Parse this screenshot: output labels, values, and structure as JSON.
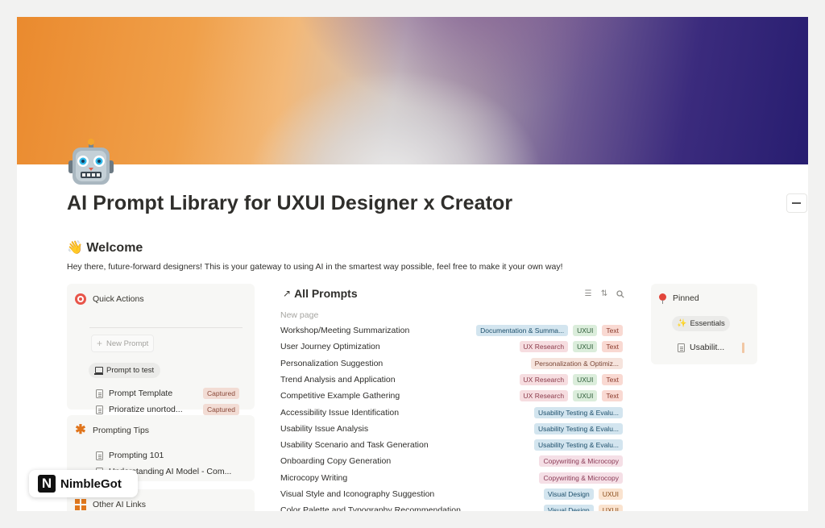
{
  "page": {
    "title": "AI Prompt Library for UXUI Designer x Creator",
    "icon": "robot-icon"
  },
  "welcome": {
    "heading": "👋 Welcome",
    "text": "Hey there, future-forward designers! This is your gateway to using AI in the smartest way possible, feel free to make it your own way!"
  },
  "quick_actions": {
    "title": "Quick Actions",
    "new_prompt_label": "New Prompt",
    "prompt_to_test_label": "Prompt to test",
    "items": [
      {
        "label": "Prompt Template",
        "tag": "Captured"
      },
      {
        "label": "Prioratize unortod...",
        "tag": "Captured"
      }
    ]
  },
  "prompting_tips": {
    "title": "Prompting Tips",
    "items": [
      {
        "label": "Prompting 101"
      },
      {
        "label": "Understanding AI Model - Com..."
      }
    ]
  },
  "other_links": {
    "title": "Other AI Links"
  },
  "all_prompts": {
    "title": "All Prompts",
    "new_page_label": "New page",
    "rows": [
      {
        "name": "Workshop/Meeting Summarization",
        "tags": [
          {
            "label": "Documentation & Summa...",
            "style": "t-doc"
          },
          {
            "label": "UXUI",
            "style": "t-uxui"
          },
          {
            "label": "Text",
            "style": "t-text"
          }
        ]
      },
      {
        "name": "User Journey Optimization",
        "tags": [
          {
            "label": "UX Research",
            "style": "t-uxr"
          },
          {
            "label": "UXUI",
            "style": "t-uxui"
          },
          {
            "label": "Text",
            "style": "t-text"
          }
        ]
      },
      {
        "name": "Personalization Suggestion",
        "tags": [
          {
            "label": "Personalization & Optimiz...",
            "style": "t-pers"
          }
        ]
      },
      {
        "name": "Trend Analysis and Application",
        "tags": [
          {
            "label": "UX Research",
            "style": "t-uxr"
          },
          {
            "label": "UXUI",
            "style": "t-uxui"
          },
          {
            "label": "Text",
            "style": "t-text"
          }
        ]
      },
      {
        "name": "Competitive Example Gathering",
        "tags": [
          {
            "label": "UX Research",
            "style": "t-uxr"
          },
          {
            "label": "UXUI",
            "style": "t-uxui"
          },
          {
            "label": "Text",
            "style": "t-text"
          }
        ]
      },
      {
        "name": "Accessibility Issue Identification",
        "tags": [
          {
            "label": "Usability Testing & Evalu...",
            "style": "t-usab"
          }
        ]
      },
      {
        "name": " Usability Issue Analysis",
        "tags": [
          {
            "label": "Usability Testing & Evalu...",
            "style": "t-usab"
          }
        ]
      },
      {
        "name": "Usability Scenario and Task Generation",
        "tags": [
          {
            "label": "Usability Testing & Evalu...",
            "style": "t-usab"
          }
        ]
      },
      {
        "name": "Onboarding Copy Generation",
        "tags": [
          {
            "label": "Copywriting & Microcopy",
            "style": "t-copy"
          }
        ]
      },
      {
        "name": "Microcopy Writing",
        "tags": [
          {
            "label": "Copywriting & Microcopy",
            "style": "t-copy"
          }
        ]
      },
      {
        "name": "Visual Style and Iconography Suggestion",
        "tags": [
          {
            "label": "Visual Design",
            "style": "t-vis"
          },
          {
            "label": "UXUI",
            "style": "t-uxui2"
          }
        ]
      },
      {
        "name": "Color Palette and Typography Recommendation",
        "tags": [
          {
            "label": "Visual Design",
            "style": "t-vis"
          },
          {
            "label": "UXUI",
            "style": "t-uxui2"
          }
        ]
      }
    ]
  },
  "pinned": {
    "title": "Pinned",
    "chip_label": "Essentials",
    "item_label": "Usabilit..."
  },
  "watermark": {
    "brand": "NimbleGot"
  }
}
